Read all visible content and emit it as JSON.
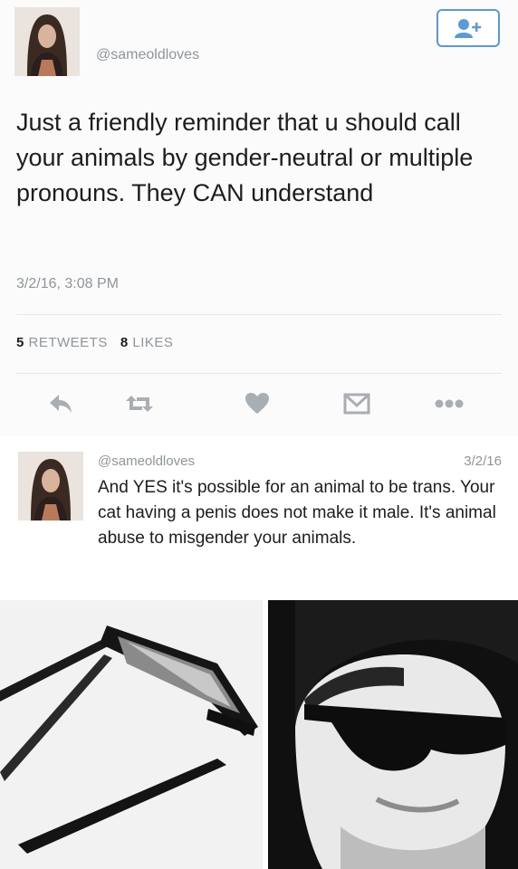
{
  "tweet": {
    "handle": "@sameoldloves",
    "text": "Just a friendly reminder that u should call your animals by gender-neutral or multiple pronouns. They CAN understand",
    "timestamp": "3/2/16, 3:08 PM",
    "retweets_count": "5",
    "retweets_label": "RETWEETS",
    "likes_count": "8",
    "likes_label": "LIKES",
    "actions": [
      "reply-icon",
      "retweet-icon",
      "like-heart-icon",
      "direct-message-icon",
      "more-icon"
    ]
  },
  "reply": {
    "handle": "@sameoldloves",
    "date": "3/2/16",
    "text": "And YES it's possible for an animal to be trans. Your cat having a penis does not make it male. It's animal abuse to misgender your animals."
  },
  "colors": {
    "accent": "#5a9ad9",
    "icon_gray": "#a9aeb3",
    "muted_text": "#8e959b"
  }
}
